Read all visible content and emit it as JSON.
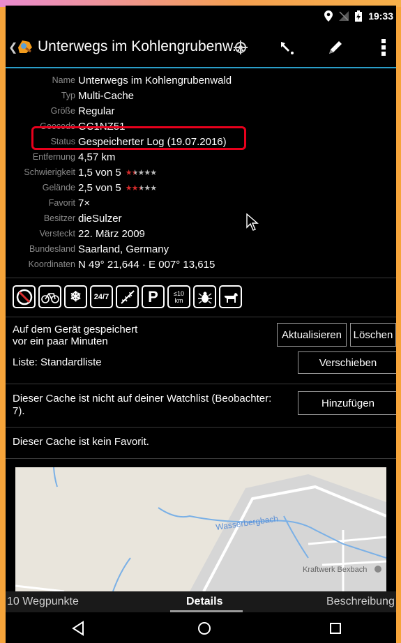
{
  "status_bar": {
    "time": "19:33"
  },
  "action_bar": {
    "back_icon": "chevron-left-icon",
    "title": "Unterwegs im Kohlengrubenw...",
    "actions": [
      "compass-icon",
      "navigate-icon",
      "edit-icon",
      "overflow-menu-icon"
    ]
  },
  "details": [
    {
      "label": "Name",
      "value": "Unterwegs im Kohlengrubenwald"
    },
    {
      "label": "Typ",
      "value": "Multi-Cache"
    },
    {
      "label": "Größe",
      "value": "Regular"
    },
    {
      "label": "Geocode",
      "value": "GC1NZ51"
    },
    {
      "label": "Status",
      "value": "Gespeicherter Log (19.07.2016)"
    },
    {
      "label": "Entfernung",
      "value": "4,57 km"
    },
    {
      "label": "Schwierigkeit",
      "value": "1,5 von 5",
      "rating": 1.5
    },
    {
      "label": "Gelände",
      "value": "2,5 von 5",
      "rating": 2.5
    },
    {
      "label": "Favorit",
      "value": "7×"
    },
    {
      "label": "Besitzer",
      "value": "dieSulzer"
    },
    {
      "label": "Versteckt",
      "value": "22. März 2009"
    },
    {
      "label": "Bundesland",
      "value": "Saarland, Germany"
    },
    {
      "label": "Koordinaten",
      "value": "N 49° 21,644 · E 007° 13,615"
    }
  ],
  "attributes": {
    "icons": [
      "no-dangerous-icon",
      "bicycle-icon",
      "snowflake-icon",
      "24-7-icon",
      "thorns-icon",
      "parking-icon",
      "under-10km-icon",
      "tick-icon",
      "dog-icon"
    ],
    "text_247": "24/7",
    "text_p": "P",
    "text_10": "≤10",
    "text_km": "km"
  },
  "storage": {
    "line1": "Auf dem Gerät gespeichert",
    "line2": "vor ein paar Minuten",
    "refresh_label": "Aktualisieren",
    "delete_label": "Löschen",
    "list_text": "Liste: Standardliste",
    "move_label": "Verschieben"
  },
  "watchlist": {
    "text_line1": "Dieser Cache ist nicht auf deiner Watchlist (Beobachter:",
    "text_line2": "7).",
    "add_label": "Hinzufügen"
  },
  "favorite": {
    "text": "Dieser Cache ist kein Favorit."
  },
  "map": {
    "label_stream": "Wasserbergbach",
    "label_plant": "Kraftwerk Bexbach"
  },
  "tabs": [
    {
      "label": "10 Wegpunkte",
      "active": false
    },
    {
      "label": "Details",
      "active": true
    },
    {
      "label": "Beschreibung",
      "active": false
    }
  ],
  "colors": {
    "accent": "#2a9ec9",
    "highlight": "#e8001c",
    "star_filled": "#d82c2c",
    "star_empty": "#bbbbbb"
  }
}
